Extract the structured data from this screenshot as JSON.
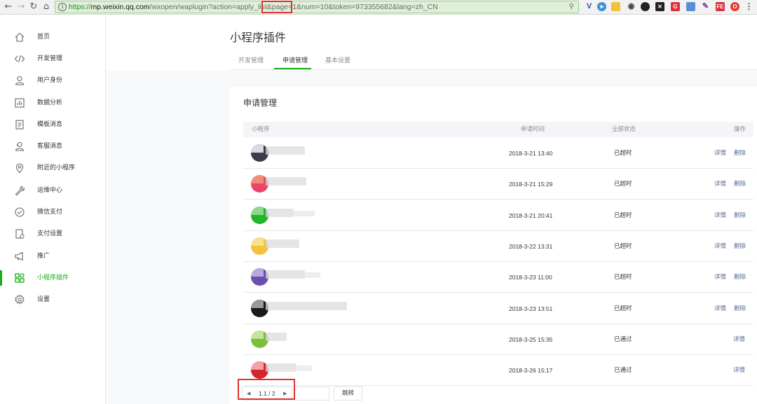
{
  "browser": {
    "back_icon": "arrow-left-icon",
    "forward_icon": "arrow-right-icon",
    "reload_icon": "reload-icon",
    "home_icon": "home-icon",
    "url_scheme": "https://",
    "url_host": "mp.weixin.qq.com",
    "url_path": "/wxopen/waplugin?action=apply_list&page=1&num=10&token=973355682&lang=zh_CN",
    "highlight_color": "#e3302f"
  },
  "sidebar": {
    "active_color": "#1aad19",
    "items": [
      {
        "label": "首页",
        "icon": "home-icon"
      },
      {
        "label": "开发管理",
        "icon": "code-icon"
      },
      {
        "label": "用户身份",
        "icon": "user-icon"
      },
      {
        "label": "数据分析",
        "icon": "bar-chart-icon"
      },
      {
        "label": "模板消息",
        "icon": "document-icon"
      },
      {
        "label": "客服消息",
        "icon": "customer-service-icon"
      },
      {
        "label": "附近的小程序",
        "icon": "location-pin-icon"
      },
      {
        "label": "运维中心",
        "icon": "wrench-icon"
      },
      {
        "label": "微信支付",
        "icon": "pay-icon"
      },
      {
        "label": "支付设置",
        "icon": "pay-settings-icon"
      },
      {
        "label": "推广",
        "icon": "megaphone-icon"
      },
      {
        "label": "小程序插件",
        "icon": "plugin-grid-icon",
        "active": true
      },
      {
        "label": "设置",
        "icon": "gear-icon"
      }
    ]
  },
  "page": {
    "title": "小程序插件",
    "tabs": [
      {
        "label": "开发管理"
      },
      {
        "label": "申请管理",
        "active": true
      },
      {
        "label": "基本设置"
      }
    ]
  },
  "panel": {
    "title": "申请管理",
    "columns": [
      "小程序",
      "申请时间",
      "全部状态",
      "操作"
    ],
    "detail_label": "详情",
    "delete_label": "删除",
    "rows": [
      {
        "time": "2018-3-21 13:40",
        "status": "已超时",
        "can_delete": true,
        "avatar_color": "#3c3c4a",
        "flag_color": "#d8d8e0"
      },
      {
        "time": "2018-3-21 15:29",
        "status": "已超时",
        "can_delete": true,
        "avatar_color": "#e9476a",
        "flag_color": "#f08c7a"
      },
      {
        "time": "2018-3-21 20:41",
        "status": "已超时",
        "can_delete": true,
        "avatar_color": "#20b52a",
        "flag_color": "#8fd98f"
      },
      {
        "time": "2018-3-22 13:31",
        "status": "已超时",
        "can_delete": true,
        "avatar_color": "#f4c23c",
        "flag_color": "#f9e08a"
      },
      {
        "time": "2018-3-23 11:00",
        "status": "已超时",
        "can_delete": true,
        "avatar_color": "#6a4fb0",
        "flag_color": "#b7a9dc"
      },
      {
        "time": "2018-3-23 13:51",
        "status": "已超时",
        "can_delete": true,
        "avatar_color": "#1a1a1a",
        "flag_color": "#9a9a9a"
      },
      {
        "time": "2018-3-25 15:35",
        "status": "已通过",
        "can_delete": false,
        "avatar_color": "#7bbf3a",
        "flag_color": "#c4e39c"
      },
      {
        "time": "2018-3-26 15:17",
        "status": "已通过",
        "can_delete": false,
        "avatar_color": "#d8242f",
        "flag_color": "#f3a0a6"
      }
    ]
  },
  "pagination": {
    "prev_icon": "caret-left-icon",
    "next_icon": "caret-right-icon",
    "text": "1.1 / 2",
    "jump_value": "",
    "jump_label": "跳转"
  }
}
